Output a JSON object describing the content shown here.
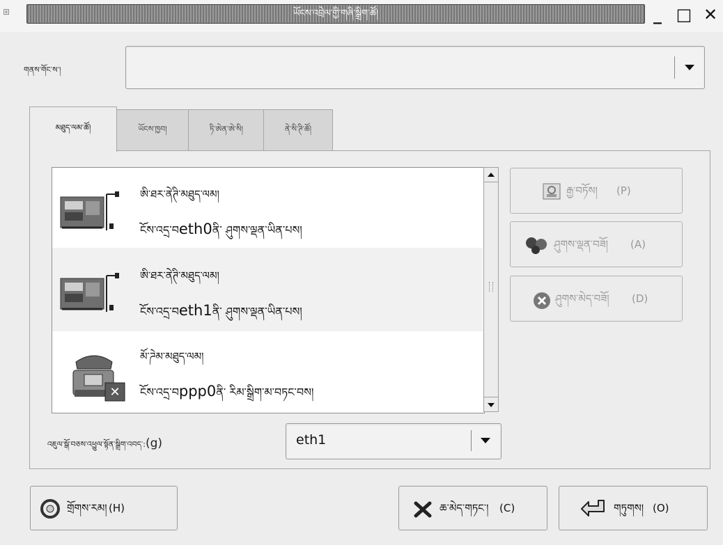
{
  "window": {
    "title": "ཡོངས་འབྲེལ་གྱི་གཞི་སྒྲིག་ཚོ།",
    "icon": "network-config-icon",
    "minimize": "_",
    "maximize": "□",
    "close": "✕"
  },
  "profile": {
    "label": "གནས་གོང་ས་།",
    "value": ""
  },
  "tabs": [
    {
      "label": "མཐུད་ལམ་ཚོ།",
      "active": true
    },
    {
      "label": "ཡོངས་ཁྱབ།",
      "active": false
    },
    {
      "label": "ཏི་ཨེན་ཨེ་སི།",
      "active": false
    },
    {
      "label": "ནེ་སི་ཊི་ཚོ།",
      "active": false
    }
  ],
  "connections": [
    {
      "title": "ཨི་ཐར་ནེཊི་མཐུད་ལམ།",
      "subtitle_pre": "ངོས་འདྲ་བ",
      "device": "eth0",
      "subtitle_post": "ནི་ ཤུགས་ལྡན་ཡིན་པས།",
      "icon": "ethernet-card-icon"
    },
    {
      "title": "ཨི་ཐར་ནེཊི་མཐུད་ལམ།",
      "subtitle_pre": "ངོས་འདྲ་བ",
      "device": "eth1",
      "subtitle_post": "ནི་ ཤུགས་ལྡན་ཡིན་པས།",
      "icon": "ethernet-card-icon"
    },
    {
      "title": "མོ་ཌེམ་མཐུད་ལམ།",
      "subtitle_pre": "ངོས་འདྲ་བ",
      "device": "ppp0",
      "subtitle_post": "ནི་ རིམ་སྒྲིག་མ་བཏང་བས།",
      "icon": "modem-phone-icon"
    }
  ],
  "actions": {
    "properties": {
      "label": "རྒྱ་བཏོས།",
      "mnemonic": "(P)"
    },
    "activate": {
      "label": "ཤུགས་ལྡན་བཟོ།",
      "mnemonic": "(A)"
    },
    "deactivate": {
      "label": "ཤུགས་མེད་བཟོ།",
      "mnemonic": "(D)"
    }
  },
  "gateway": {
    "label": "འཇུལ་སྒོ་བཅས་འཕྱུལ་སྟོན་སྒྲིག་འབད་:",
    "mnemonic": "(g)",
    "value": "eth1"
  },
  "buttons": {
    "help": {
      "label": "གྲོགས་རམ།",
      "mnemonic": "(H)"
    },
    "cancel": {
      "label": "ཆ་མེད་གཏང་།",
      "mnemonic": "(C)"
    },
    "ok": {
      "label": "གཏུགས།",
      "mnemonic": "(O)"
    }
  }
}
